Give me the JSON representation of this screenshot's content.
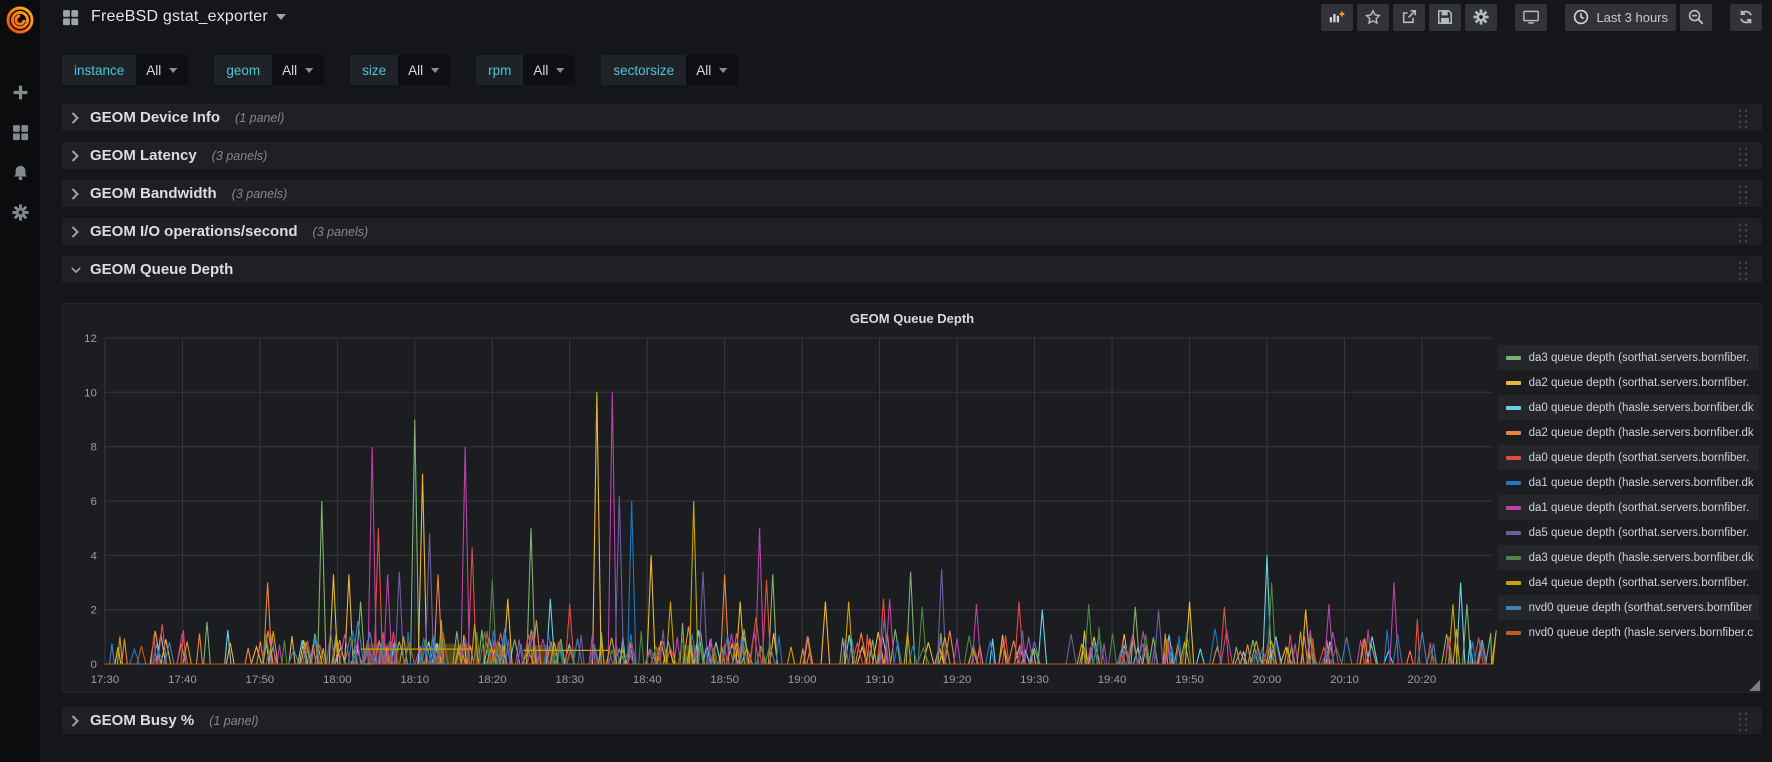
{
  "navbar": {
    "title": "FreeBSD gstat_exporter",
    "actions": [
      {
        "name": "add-panel-button",
        "icon": "add-panel"
      },
      {
        "name": "star-dashboard-button",
        "icon": "star"
      },
      {
        "name": "share-dashboard-button",
        "icon": "share"
      },
      {
        "name": "save-dashboard-button",
        "icon": "save"
      },
      {
        "name": "dashboard-settings-button",
        "icon": "gear"
      }
    ],
    "view_mode_button": {
      "name": "cycle-view-mode-button",
      "icon": "tv"
    },
    "time_range": {
      "label": "Last 3 hours",
      "icon": "clock"
    },
    "zoom_out_button": {
      "name": "zoom-out-time-button",
      "icon": "search-minus"
    },
    "refresh_button": {
      "name": "refresh-dashboard-button",
      "icon": "refresh"
    }
  },
  "sidebar": {
    "icons": [
      {
        "name": "create-plus-icon",
        "icon": "plus"
      },
      {
        "name": "dashboards-icon",
        "icon": "grid4"
      },
      {
        "name": "alerting-bell-icon",
        "icon": "bell"
      },
      {
        "name": "configuration-gear-icon",
        "icon": "gear"
      }
    ]
  },
  "variables": [
    {
      "label": "instance",
      "value": "All"
    },
    {
      "label": "geom",
      "value": "All"
    },
    {
      "label": "size",
      "value": "All"
    },
    {
      "label": "rpm",
      "value": "All"
    },
    {
      "label": "sectorsize",
      "value": "All"
    }
  ],
  "rows": [
    {
      "title": "GEOM Device Info",
      "count": "(1 panel)",
      "collapsed": true
    },
    {
      "title": "GEOM Latency",
      "count": "(3 panels)",
      "collapsed": true
    },
    {
      "title": "GEOM Bandwidth",
      "count": "(3 panels)",
      "collapsed": true
    },
    {
      "title": "GEOM I/O operations/second",
      "count": "(3 panels)",
      "collapsed": true
    },
    {
      "title": "GEOM Queue Depth",
      "count": "",
      "collapsed": false
    },
    {
      "title": "GEOM Busy %",
      "count": "(1 panel)",
      "collapsed": true
    }
  ],
  "panel": {
    "title": "GEOM Queue Depth"
  },
  "chart_data": {
    "type": "line",
    "title": "GEOM Queue Depth",
    "xlabel": "",
    "ylabel": "",
    "ylim": [
      0,
      12
    ],
    "y_ticks": [
      0,
      2,
      4,
      6,
      8,
      10,
      12
    ],
    "x_ticks": [
      "17:30",
      "17:40",
      "17:50",
      "18:00",
      "18:10",
      "18:20",
      "18:30",
      "18:40",
      "18:50",
      "19:00",
      "19:10",
      "19:20",
      "19:30",
      "19:40",
      "19:50",
      "20:00",
      "20:10",
      "20:20"
    ],
    "x_domain_minutes": [
      0,
      179
    ],
    "grid": true,
    "legend_position": "right",
    "series": [
      {
        "label": "da3 queue depth (sorthat.servers.bornfiber.",
        "color": "#7EB26D"
      },
      {
        "label": "da2 queue depth (sorthat.servers.bornfiber.",
        "color": "#EAB839"
      },
      {
        "label": "da0 queue depth (hasle.servers.bornfiber.dk",
        "color": "#6ED0E0"
      },
      {
        "label": "da2 queue depth (hasle.servers.bornfiber.dk",
        "color": "#EF843C"
      },
      {
        "label": "da0 queue depth (sorthat.servers.bornfiber.",
        "color": "#E24D42"
      },
      {
        "label": "da1 queue depth (hasle.servers.bornfiber.dk",
        "color": "#1F78C1"
      },
      {
        "label": "da1 queue depth (sorthat.servers.bornfiber.",
        "color": "#BA43A9"
      },
      {
        "label": "da5 queue depth (sorthat.servers.bornfiber.",
        "color": "#705DA0"
      },
      {
        "label": "da3 queue depth (hasle.servers.bornfiber.dk",
        "color": "#508642"
      },
      {
        "label": "da4 queue depth (sorthat.servers.bornfiber.",
        "color": "#CCA300"
      },
      {
        "label": "nvd0 queue depth (sorthat.servers.bornfiber",
        "color": "#447EBC"
      },
      {
        "label": "nvd0 queue depth (hasle.servers.bornfiber.c",
        "color": "#C15C17"
      }
    ],
    "noise_profile": {
      "description": "dense multi-colored spikes of 0.4-1.4 along the zero baseline, denser between 17:50 and 18:55",
      "baseline_max": 1.4,
      "quiet_zones_min": [
        [
          13.5,
          19
        ],
        [
          92,
          95
        ],
        [
          121,
          124.5
        ],
        [
          140.5,
          143
        ],
        [
          159,
          162
        ],
        [
          171.5,
          173
        ]
      ]
    },
    "fill_regions": [
      {
        "from_min": 34,
        "to_min": 38,
        "height": 0.75,
        "series": 9
      },
      {
        "from_min": 43,
        "to_min": 47,
        "height": 0.75,
        "series": 9
      },
      {
        "from_min": 55,
        "to_min": 58,
        "height": 0.7,
        "series": 9
      },
      {
        "from_min": 74.5,
        "to_min": 76.5,
        "height": 0.7,
        "series": 9
      }
    ],
    "elevated_segments": [
      {
        "series": 9,
        "from_min": 33,
        "to_min": 47.5,
        "value": 0.55
      },
      {
        "series": 9,
        "from_min": 54,
        "to_min": 65,
        "value": 0.5
      }
    ],
    "major_spikes": [
      {
        "min": 21,
        "value": 3.0,
        "series": 3
      },
      {
        "min": 28,
        "value": 6.0,
        "series": 0
      },
      {
        "min": 29.5,
        "value": 3.3,
        "series": 1
      },
      {
        "min": 31.5,
        "value": 3.3,
        "series": 1
      },
      {
        "min": 33,
        "value": 2.3,
        "series": 0
      },
      {
        "min": 34.5,
        "value": 8.0,
        "series": 6
      },
      {
        "min": 35.3,
        "value": 5.0,
        "series": 4
      },
      {
        "min": 36.5,
        "value": 3.3,
        "series": 6
      },
      {
        "min": 38,
        "value": 3.4,
        "series": 7
      },
      {
        "min": 40,
        "value": 9.0,
        "series": 0
      },
      {
        "min": 41,
        "value": 7.0,
        "series": 1
      },
      {
        "min": 41.9,
        "value": 4.8,
        "series": 7
      },
      {
        "min": 43,
        "value": 3.3,
        "series": 3
      },
      {
        "min": 46.5,
        "value": 8.0,
        "series": 6
      },
      {
        "min": 47.4,
        "value": 4.3,
        "series": 4
      },
      {
        "min": 50,
        "value": 3.1,
        "series": 8
      },
      {
        "min": 52,
        "value": 2.4,
        "series": 1
      },
      {
        "min": 55,
        "value": 5.0,
        "series": 0
      },
      {
        "min": 57.5,
        "value": 2.4,
        "series": 2
      },
      {
        "min": 60,
        "value": 2.2,
        "series": 4
      },
      {
        "min": 63.5,
        "value": 10.0,
        "series": 1
      },
      {
        "min": 65.5,
        "value": 10.0,
        "series": 6
      },
      {
        "min": 66.4,
        "value": 6.2,
        "series": 7
      },
      {
        "min": 68,
        "value": 6.0,
        "series": 5
      },
      {
        "min": 70.5,
        "value": 4.0,
        "series": 1
      },
      {
        "min": 73,
        "value": 2.3,
        "series": 9
      },
      {
        "min": 76,
        "value": 6.0,
        "series": 9
      },
      {
        "min": 77.2,
        "value": 3.4,
        "series": 7
      },
      {
        "min": 80,
        "value": 3.3,
        "series": 3
      },
      {
        "min": 82,
        "value": 2.3,
        "series": 1
      },
      {
        "min": 84.5,
        "value": 5.0,
        "series": 6
      },
      {
        "min": 85.4,
        "value": 3.1,
        "series": 4
      },
      {
        "min": 86.2,
        "value": 3.3,
        "series": 0
      },
      {
        "min": 93,
        "value": 2.3,
        "series": 1
      },
      {
        "min": 96,
        "value": 2.3,
        "series": 9
      },
      {
        "min": 100.5,
        "value": 2.4,
        "series": 4
      },
      {
        "min": 101.3,
        "value": 2.4,
        "series": 6
      },
      {
        "min": 104,
        "value": 3.4,
        "series": 0
      },
      {
        "min": 105.5,
        "value": 2.1,
        "series": 8
      },
      {
        "min": 108,
        "value": 3.5,
        "series": 7
      },
      {
        "min": 112.5,
        "value": 2.2,
        "series": 6
      },
      {
        "min": 118,
        "value": 2.3,
        "series": 4
      },
      {
        "min": 121,
        "value": 2.0,
        "series": 2
      },
      {
        "min": 127,
        "value": 2.2,
        "series": 8
      },
      {
        "min": 133,
        "value": 2.1,
        "series": 0
      },
      {
        "min": 136,
        "value": 2.0,
        "series": 7
      },
      {
        "min": 140,
        "value": 2.3,
        "series": 1
      },
      {
        "min": 144.5,
        "value": 2.1,
        "series": 4
      },
      {
        "min": 150,
        "value": 4.0,
        "series": 2
      },
      {
        "min": 150.6,
        "value": 3.0,
        "series": 8
      },
      {
        "min": 155,
        "value": 2.0,
        "series": 1
      },
      {
        "min": 158,
        "value": 2.2,
        "series": 6
      },
      {
        "min": 166.4,
        "value": 3.0,
        "series": 6
      },
      {
        "min": 174,
        "value": 2.2,
        "series": 9
      },
      {
        "min": 175,
        "value": 3.0,
        "series": 2
      },
      {
        "min": 175.8,
        "value": 2.2,
        "series": 0
      }
    ]
  },
  "colors": {
    "page_bg": "#141619",
    "row_bg": "#1e2024",
    "panel_bg": "#1b1d21",
    "grid_line": "#35383d",
    "variable_label": "#4fc3dd",
    "accent_orange": "#f79520"
  }
}
